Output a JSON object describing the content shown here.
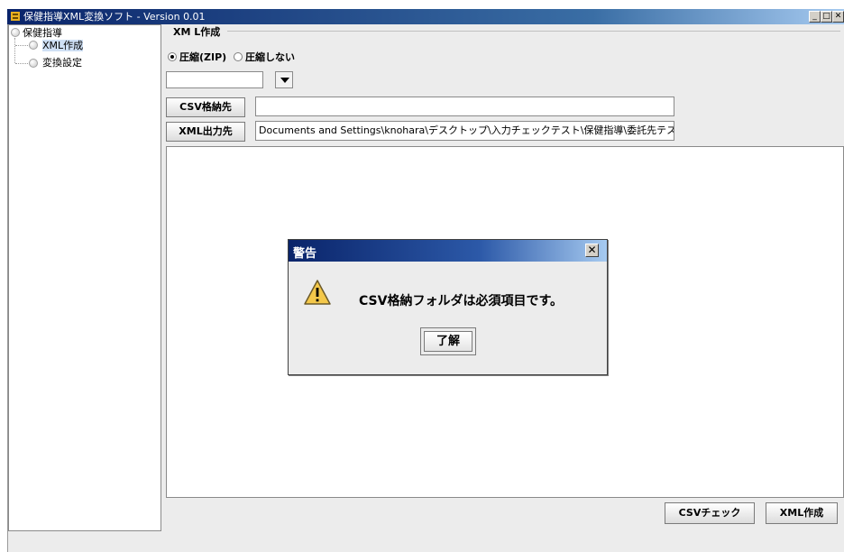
{
  "window": {
    "title": "保健指導XML変換ソフト - Version 0.01",
    "controls": {
      "minimize": "_",
      "maximize": "□",
      "close": "✕"
    }
  },
  "tree": {
    "root": "保健指導",
    "items": [
      {
        "label": "XML作成",
        "selected": true
      },
      {
        "label": "変換設定",
        "selected": false
      }
    ]
  },
  "main": {
    "section_title": "XM L作成",
    "radio_options": [
      {
        "label": "圧縮(ZIP)",
        "checked": true
      },
      {
        "label": "圧縮しない",
        "checked": false
      }
    ],
    "combo_value": "",
    "csv_button": "CSV格納先",
    "csv_path": "",
    "xml_button": "XML出力先",
    "xml_path": "Documents and Settings\\knohara\\デスクトップ\\入力チェックテスト\\保健指導\\委託先テスト",
    "check_button": "CSVチェック",
    "create_button": "XML作成"
  },
  "dialog": {
    "title": "警告",
    "icon": "warning-icon",
    "message": "CSV格納フォルダは必須項目です。",
    "ok_label": "了解"
  },
  "colors": {
    "title_bar": "#0a246a",
    "selection": "#cfe0f5",
    "warning": "#f4c84a"
  }
}
